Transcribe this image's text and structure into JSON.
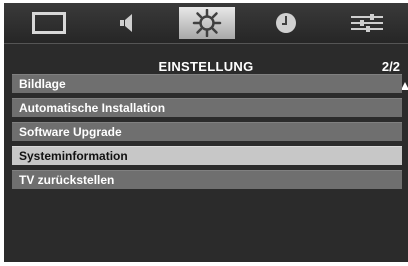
{
  "tabs": [
    {
      "name": "picture-tab",
      "icon": "screen-icon"
    },
    {
      "name": "sound-tab",
      "icon": "speaker-icon"
    },
    {
      "name": "settings-tab",
      "icon": "gear-icon",
      "active": true
    },
    {
      "name": "timer-tab",
      "icon": "clock-icon"
    },
    {
      "name": "adjust-tab",
      "icon": "sliders-icon"
    }
  ],
  "menu": {
    "title": "EINSTELLUNG",
    "page": "2/2",
    "items": [
      {
        "label": "Bildlage"
      },
      {
        "label": "Automatische Installation"
      },
      {
        "label": "Software Upgrade"
      },
      {
        "label": "Systeminformation",
        "selected": true
      },
      {
        "label": "TV zurückstellen"
      }
    ]
  },
  "colors": {
    "background": "#2b2b2b",
    "item": "#6f6f6f",
    "item_selected": "#c7c7c7",
    "tab_active": "#d0d0d0"
  }
}
